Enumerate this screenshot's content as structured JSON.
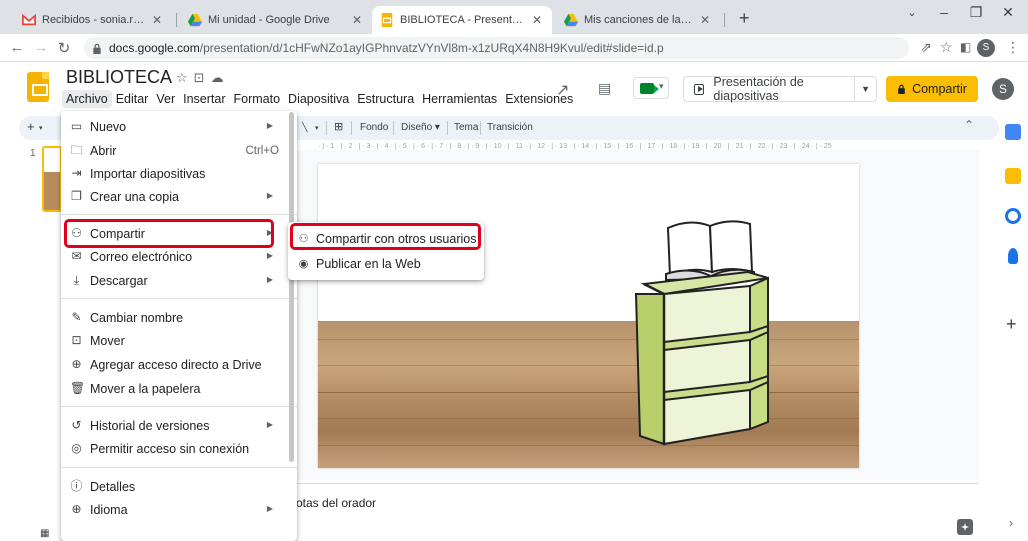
{
  "browser": {
    "tabs": [
      {
        "title": "Recibidos - sonia.raymundo.ar© ",
        "favicon": "gmail-icon"
      },
      {
        "title": "Mi unidad - Google Drive",
        "favicon": "drive-icon"
      },
      {
        "title": "BIBLIOTECA - Presentaciones de ",
        "favicon": "slides-icon"
      },
      {
        "title": "Mis canciones de la granja.pdf - ",
        "favicon": "drive-icon"
      }
    ],
    "active_tab": 2,
    "address": {
      "host": "docs.google.com",
      "path": "/presentation/d/1cHFwNZo1ayIGPhnvatzVYnVl8m-x1zURqX4N8H9Kvul/edit#slide=id.p"
    },
    "profile_initial": "S"
  },
  "app": {
    "doc_title": "BIBLIOTECA",
    "menus": [
      "Archivo",
      "Editar",
      "Ver",
      "Insertar",
      "Formato",
      "Diapositiva",
      "Estructura",
      "Herramientas",
      "Extensiones"
    ],
    "active_menu": "Archivo",
    "present_label": "Presentación de diapositivas",
    "share_label": "Compartir",
    "user_initial": "S"
  },
  "toolbar": {
    "fondo": "Fondo",
    "diseno": "Diseño",
    "tema": "Tema",
    "transicion": "Transición"
  },
  "filmstrip": {
    "slide_number": "1"
  },
  "ruler_text": "· | · 1 · | · 2 · | · 3 · | · 4 · | · 5 · | · 6 · | · 7 · | · 8 · | · 9 · | · 10 · | · 11 · | · 12 · | · 13 · | · 14 · | · 15 · | · 16 · | · 17 · | · 18 · | · 19 · | · 20 · | · 21 · | · 22 · | · 23 · | · 24 · | · 25",
  "notes_placeholder": "otas del orador",
  "file_menu": {
    "items": [
      {
        "label": "Nuevo",
        "icon": "new-slides-icon",
        "shortcut": "",
        "submenu": true
      },
      {
        "label": "Abrir",
        "icon": "folder-icon",
        "shortcut": "Ctrl+O",
        "submenu": false
      },
      {
        "label": "Importar diapositivas",
        "icon": "import-icon",
        "shortcut": "",
        "submenu": false
      },
      {
        "label": "Crear una copia",
        "icon": "copy-icon",
        "shortcut": "",
        "submenu": true
      },
      {
        "label": "Compartir",
        "icon": "person-add-icon",
        "shortcut": "",
        "submenu": true
      },
      {
        "label": "Correo electrónico",
        "icon": "email-icon",
        "shortcut": "",
        "submenu": true
      },
      {
        "label": "Descargar",
        "icon": "download-icon",
        "shortcut": "",
        "submenu": true
      },
      {
        "label": "Cambiar nombre",
        "icon": "rename-icon",
        "shortcut": "",
        "submenu": false
      },
      {
        "label": "Mover",
        "icon": "move-icon",
        "shortcut": "",
        "submenu": false
      },
      {
        "label": "Agregar acceso directo a Drive",
        "icon": "shortcut-icon",
        "shortcut": "",
        "submenu": false
      },
      {
        "label": "Mover a la papelera",
        "icon": "trash-icon",
        "shortcut": "",
        "submenu": false
      },
      {
        "label": "Historial de versiones",
        "icon": "history-icon",
        "shortcut": "",
        "submenu": true
      },
      {
        "label": "Permitir acceso sin conexión",
        "icon": "offline-icon",
        "shortcut": "",
        "submenu": false
      },
      {
        "label": "Detalles",
        "icon": "info-icon",
        "shortcut": "",
        "submenu": false
      },
      {
        "label": "Idioma",
        "icon": "globe-icon",
        "shortcut": "",
        "submenu": true
      }
    ],
    "highlighted": "Compartir"
  },
  "share_submenu": {
    "items": [
      {
        "label": "Compartir con otros usuarios",
        "icon": "person-add-icon"
      },
      {
        "label": "Publicar en la Web",
        "icon": "publish-web-icon"
      }
    ],
    "highlighted": "Compartir con otros usuarios"
  },
  "colors": {
    "share_button": "#fbbc04",
    "highlight_box": "#e0001b",
    "slides_brand": "#f4b400"
  }
}
